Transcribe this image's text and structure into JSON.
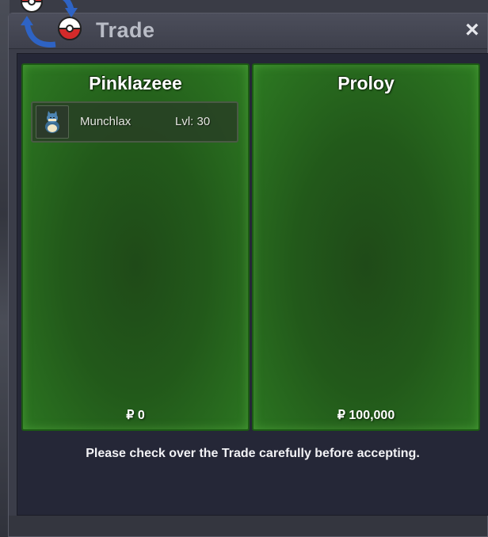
{
  "window": {
    "title": "Trade",
    "close_icon": "×"
  },
  "left_panel": {
    "player_name": "Pinklazeee",
    "items": [
      {
        "icon": "munchlax-sprite-icon",
        "name": "Munchlax",
        "level": "Lvl: 30"
      }
    ],
    "money": "₽ 0"
  },
  "right_panel": {
    "player_name": "Proloy",
    "items": [],
    "money": "₽ 100,000"
  },
  "notice": "Please check over the Trade carefully before accepting.",
  "colors": {
    "panel_green": "#22591a",
    "panel_border": "#1c5a14",
    "window_bg": "#3b3d49",
    "content_bg": "#252737"
  }
}
